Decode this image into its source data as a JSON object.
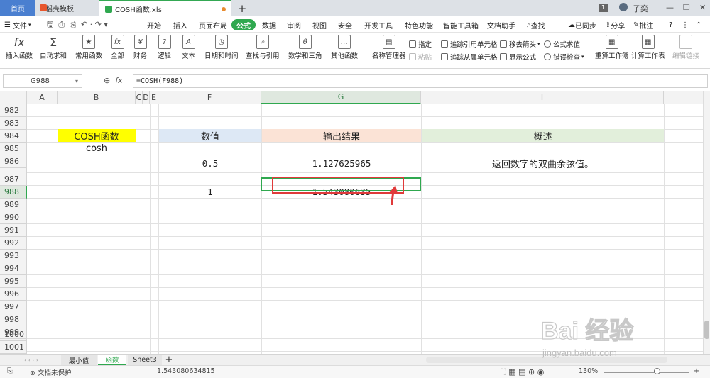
{
  "titlebar": {
    "tabs": [
      "首页",
      "稻壳模板",
      "COSH函数.xls"
    ],
    "user": "子奕",
    "badge": "1"
  },
  "menubar": {
    "file": "文件",
    "items": [
      "开始",
      "插入",
      "页面布局",
      "公式",
      "数据",
      "审阅",
      "视图",
      "安全",
      "开发工具",
      "特色功能",
      "智能工具箱",
      "文档助手"
    ],
    "search": "查找",
    "sync": "已同步",
    "share": "分享",
    "comment": "批注"
  },
  "ribbon": {
    "big": [
      "插入函数",
      "自动求和",
      "常用函数",
      "全部",
      "财务",
      "逻辑",
      "文本",
      "日期和时间",
      "查找与引用",
      "数学和三角",
      "其他函数",
      "名称管理器",
      "重算工作簿",
      "计算工作表",
      "编辑链接"
    ],
    "small": [
      "指定",
      "粘贴",
      "追踪引用单元格",
      "追踪从属单元格",
      "移去箭头",
      "显示公式",
      "公式求值",
      "错误检查"
    ]
  },
  "formula_bar": {
    "name_box": "G988",
    "fx": "fx",
    "formula": "=COSH(F988)"
  },
  "grid": {
    "columns": [
      "A",
      "B",
      "C",
      "D",
      "E",
      "F",
      "G",
      "I"
    ],
    "rows": [
      "982",
      "983",
      "984",
      "985",
      "986",
      "987",
      "988",
      "989",
      "990",
      "991",
      "992",
      "993",
      "994",
      "995",
      "996",
      "997",
      "998",
      "999",
      "1000",
      "1001"
    ],
    "cells": {
      "B984": "COSH函数",
      "B985": "cosh",
      "F984": "数值",
      "G984": "输出结果",
      "I984": "概述",
      "F986": "0.5",
      "G986": "1.127625965",
      "I986": "返回数字的双曲余弦值。",
      "F988": "1",
      "G988": "1.543080635"
    }
  },
  "colors": {
    "accent_green": "#2fa84f",
    "b984_fill": "#ffff00",
    "f984_fill": "#dde8f5",
    "g984_fill": "#fbe3d6",
    "i984_fill": "#e2efdb",
    "annotation_red": "#e03a3a"
  },
  "sheets": [
    "最小值",
    "函数",
    "Sheet3"
  ],
  "statusbar": {
    "protect": "文档未保护",
    "value": "1.543080634815",
    "zoom": "130%"
  },
  "watermark": {
    "brand": "Bai 经验",
    "url": "jingyan.baidu.com"
  }
}
